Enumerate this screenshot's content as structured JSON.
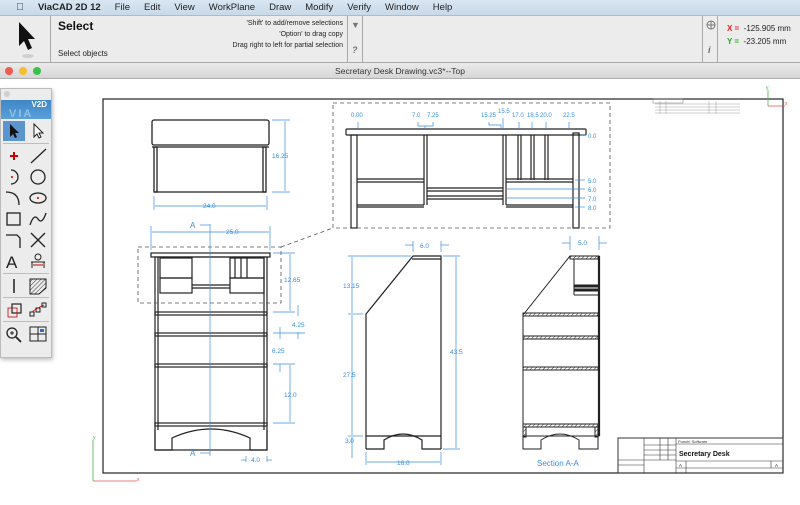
{
  "menubar": {
    "app_name": "ViaCAD 2D 12",
    "items": [
      "File",
      "Edit",
      "View",
      "WorkPlane",
      "Draw",
      "Modify",
      "Verify",
      "Window",
      "Help"
    ]
  },
  "status": {
    "tool_title": "Select",
    "tool_subtitle": "Select objects",
    "hints": [
      "'Shift' to add/remove selections",
      "'Option' to drag copy",
      "Drag right to left for partial selection"
    ],
    "help_glyph": "?",
    "info_glyph": "i",
    "x_label": "X =",
    "x_value": "-125.905 mm",
    "y_label": "Y =",
    "y_value": "-23.205 mm",
    "colors": {
      "x": "#d22222",
      "y": "#22aa22"
    }
  },
  "document": {
    "title": "Secretary Desk Drawing.vc3*--Top"
  },
  "palette": {
    "brand_top": "V2D",
    "brand_bottom": "VIA",
    "tools": [
      "select-arrow",
      "select-hollow-arrow",
      "point",
      "line",
      "arc",
      "circle",
      "fillet-arc",
      "ellipse",
      "rectangle",
      "spline",
      "corner",
      "trim-cross",
      "text",
      "dimension",
      "vertical-line",
      "hatch",
      "transform",
      "node-edit",
      "zoom",
      "view-layout"
    ]
  },
  "drawing": {
    "accent_color": "#3a8ee0",
    "top_view": {
      "width_dim": "24.0",
      "depth_dim": "16.25"
    },
    "front_view": {
      "width_dim": "25.0",
      "section_marker": "A",
      "dims": [
        "12.65",
        "4.25",
        "6.25",
        "12.0",
        "4.0"
      ]
    },
    "detail_view": {
      "x_ordinates": [
        "0.00",
        "7.0",
        "7.25",
        "15.25",
        "15.5",
        "17.0",
        "18.5",
        "20.0",
        "22.5"
      ],
      "y_ordinates": [
        "0.0",
        "5.0",
        "6.0",
        "7.0",
        "8.0"
      ]
    },
    "side_view": {
      "dims": [
        "6.0",
        "13.15",
        "27.5",
        "3.0",
        "43.5",
        "16.0"
      ]
    },
    "section_view": {
      "dims": [
        "5.0"
      ],
      "label": "Section A-A"
    },
    "title_block": {
      "company": "Punch! Software",
      "title": "Secretary Desk",
      "size": "A",
      "rev": "A"
    },
    "axis_labels": {
      "x": "x",
      "y": "y"
    }
  }
}
